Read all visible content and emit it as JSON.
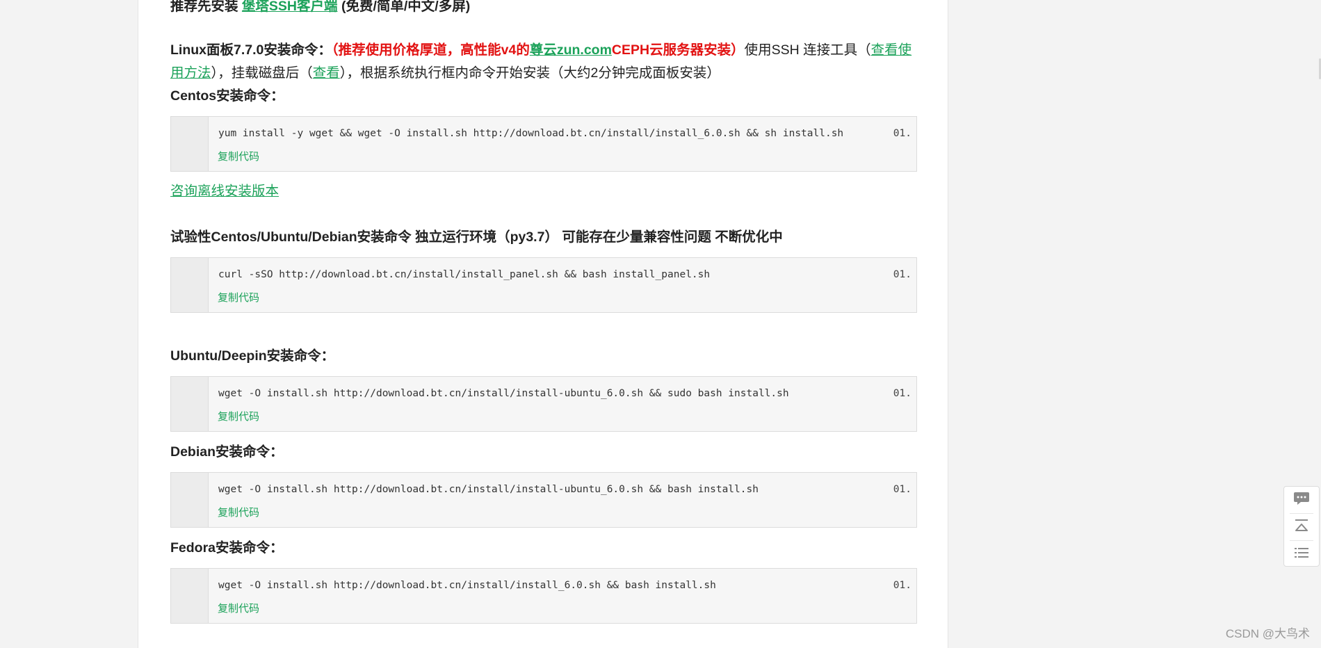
{
  "intro": {
    "prefix": "推荐先安装 ",
    "link": "堡塔SSH客户端",
    "suffix": " (免费/简单/中文/多屏)"
  },
  "linux_panel": {
    "label": "Linux面板7.7.0安装命令：",
    "red_open": "（推荐使用价格厚道，高性能v4的",
    "red_link": "尊云zun.com",
    "red_close": "CEPH云服务器安装）",
    "text1": "使用SSH 连接工具（",
    "link_howto": "查看使用方法",
    "text2": "），挂载磁盘后（",
    "link_view": "查看",
    "text3": "），根据系统执行框内命令开始安装（大约2分钟完成面板安装）"
  },
  "centos": {
    "heading": "Centos安装命令：",
    "line_no": "01.",
    "code": "yum install -y wget && wget -O install.sh http://download.bt.cn/install/install_6.0.sh && sh install.sh",
    "copy": "复制代码"
  },
  "offline_link": "咨询离线安装版本",
  "experimental": {
    "heading": "试验性Centos/Ubuntu/Debian安装命令 独立运行环境（py3.7） 可能存在少量兼容性问题 不断优化中",
    "line_no": "01.",
    "code": "curl -sSO http://download.bt.cn/install/install_panel.sh && bash install_panel.sh",
    "copy": "复制代码"
  },
  "ubuntu": {
    "heading": "Ubuntu/Deepin安装命令：",
    "line_no": "01.",
    "code": "wget -O install.sh http://download.bt.cn/install/install-ubuntu_6.0.sh && sudo bash install.sh",
    "copy": "复制代码"
  },
  "debian": {
    "heading": "Debian安装命令：",
    "line_no": "01.",
    "code": "wget -O install.sh http://download.bt.cn/install/install-ubuntu_6.0.sh && bash install.sh",
    "copy": "复制代码"
  },
  "fedora": {
    "heading": "Fedora安装命令：",
    "line_no": "01.",
    "code": "wget -O install.sh http://download.bt.cn/install/install_6.0.sh && bash install.sh",
    "copy": "复制代码"
  },
  "side_tools": {
    "icons": [
      "comment-icon",
      "back-to-top-icon",
      "list-icon"
    ]
  },
  "watermark": "CSDN @大鸟术",
  "colors": {
    "link_green": "#1ca25a",
    "accent_red": "#e21212"
  }
}
